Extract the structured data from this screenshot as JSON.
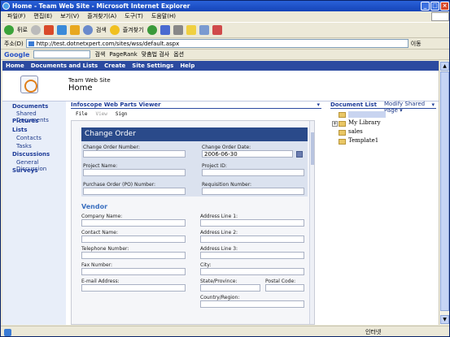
{
  "window": {
    "title": "Home - Team Web Site - Microsoft Internet Explorer"
  },
  "menubar": [
    "파일(F)",
    "편집(E)",
    "보기(V)",
    "즐겨찾기(A)",
    "도구(T)",
    "도움말(H)"
  ],
  "toolbar": {
    "back": "뒤로",
    "search": "검색",
    "favorites": "즐겨찾기"
  },
  "address": {
    "label": "주소(D)",
    "url": "http://test.dotnetxpert.com/sites/wss/default.aspx",
    "go": "이동"
  },
  "google": {
    "logo": "Google",
    "search": "검색",
    "pagerank": "PageRank",
    "spell": "맞춤법 검사",
    "options": "옵션"
  },
  "sp": {
    "topnav": [
      "Home",
      "Documents and Lists",
      "Create",
      "Site Settings",
      "Help"
    ],
    "site_name": "Team Web Site",
    "page_title": "Home",
    "modify": "Modify Shared Page ▾",
    "leftnav": [
      {
        "label": "Documents",
        "head": true
      },
      {
        "label": "Shared Documents",
        "head": false
      },
      {
        "label": "Pictures",
        "head": true
      },
      {
        "label": "Lists",
        "head": true
      },
      {
        "label": "Contacts",
        "head": false
      },
      {
        "label": "Tasks",
        "head": false
      },
      {
        "label": "Discussions",
        "head": true
      },
      {
        "label": "General Discussion",
        "head": false
      },
      {
        "label": "Surveys",
        "head": true
      }
    ],
    "webpart_title": "Infoscope Web Parts Viewer",
    "ip_menu": {
      "file": "File",
      "view": "View",
      "sign": "Sign"
    },
    "form": {
      "banner": "Change Order",
      "change_order_number": "Change Order Number:",
      "change_order_date": "Change Order Date:",
      "date_value": "2006-06-30",
      "project_name": "Project Name:",
      "project_id": "Project ID:",
      "po_number": "Purchase Order (PO) Number:",
      "requisition": "Requisition Number:",
      "vendor": "Vendor",
      "company": "Company Name:",
      "addr1": "Address Line 1:",
      "contact": "Contact Name:",
      "addr2": "Address Line 2:",
      "phone": "Telephone Number:",
      "addr3": "Address Line 3:",
      "fax": "Fax Number:",
      "city": "City:",
      "email": "E-mail Address:",
      "state": "State/Province:",
      "postal": "Postal Code:",
      "country": "Country/Region:"
    },
    "doclist_title": "Document List",
    "doclist": [
      "My Library",
      "sales",
      "Template1"
    ]
  },
  "status": {
    "zone": "인터넷"
  }
}
